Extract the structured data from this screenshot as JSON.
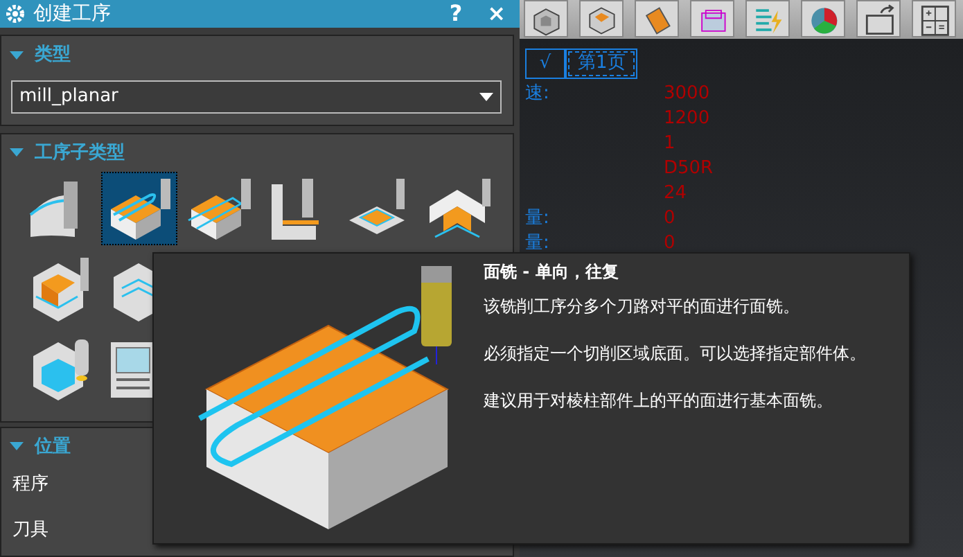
{
  "dialog": {
    "title": "创建工序",
    "help": "?",
    "close": "×"
  },
  "type_section": {
    "title": "类型",
    "expanded": true,
    "value": "mill_planar"
  },
  "subtype_section": {
    "title": "工序子类型",
    "expanded": true,
    "items": [
      {
        "selected": false
      },
      {
        "selected": true
      },
      {
        "selected": false
      },
      {
        "selected": false
      },
      {
        "selected": false
      },
      {
        "selected": false
      },
      {
        "selected": false
      },
      {
        "selected": false
      },
      {
        "selected": false
      },
      {
        "selected": false
      }
    ]
  },
  "location_section": {
    "title": "位置",
    "expanded": true,
    "rows": [
      "程序",
      "刀具"
    ]
  },
  "toolbar": {
    "buttons": [
      {
        "kind": "block"
      },
      {
        "kind": "hexagon"
      },
      {
        "kind": "wedge"
      },
      {
        "kind": "box"
      },
      {
        "kind": "list"
      },
      {
        "kind": "pie"
      },
      {
        "kind": "folder"
      },
      {
        "kind": "calc"
      }
    ]
  },
  "sheet": {
    "check": "√",
    "tab": "第1页",
    "params": [
      {
        "label": "速:",
        "value": "3000"
      },
      {
        "value": "1200"
      },
      {
        "value": "1"
      },
      {
        "value": "D50R"
      },
      {
        "value": "24"
      },
      {
        "label": "量:",
        "value": "0"
      },
      {
        "label": "量:",
        "value": "0"
      }
    ]
  },
  "tooltip": {
    "title": "面铣 - 单向，往复",
    "paragraphs": [
      "该铣削工序分多个刀路对平的面进行面铣。",
      "必须指定一个切削区域底面。可以选择指定部件体。",
      "建议用于对棱柱部件上的平的面进行基本面铣。"
    ]
  }
}
